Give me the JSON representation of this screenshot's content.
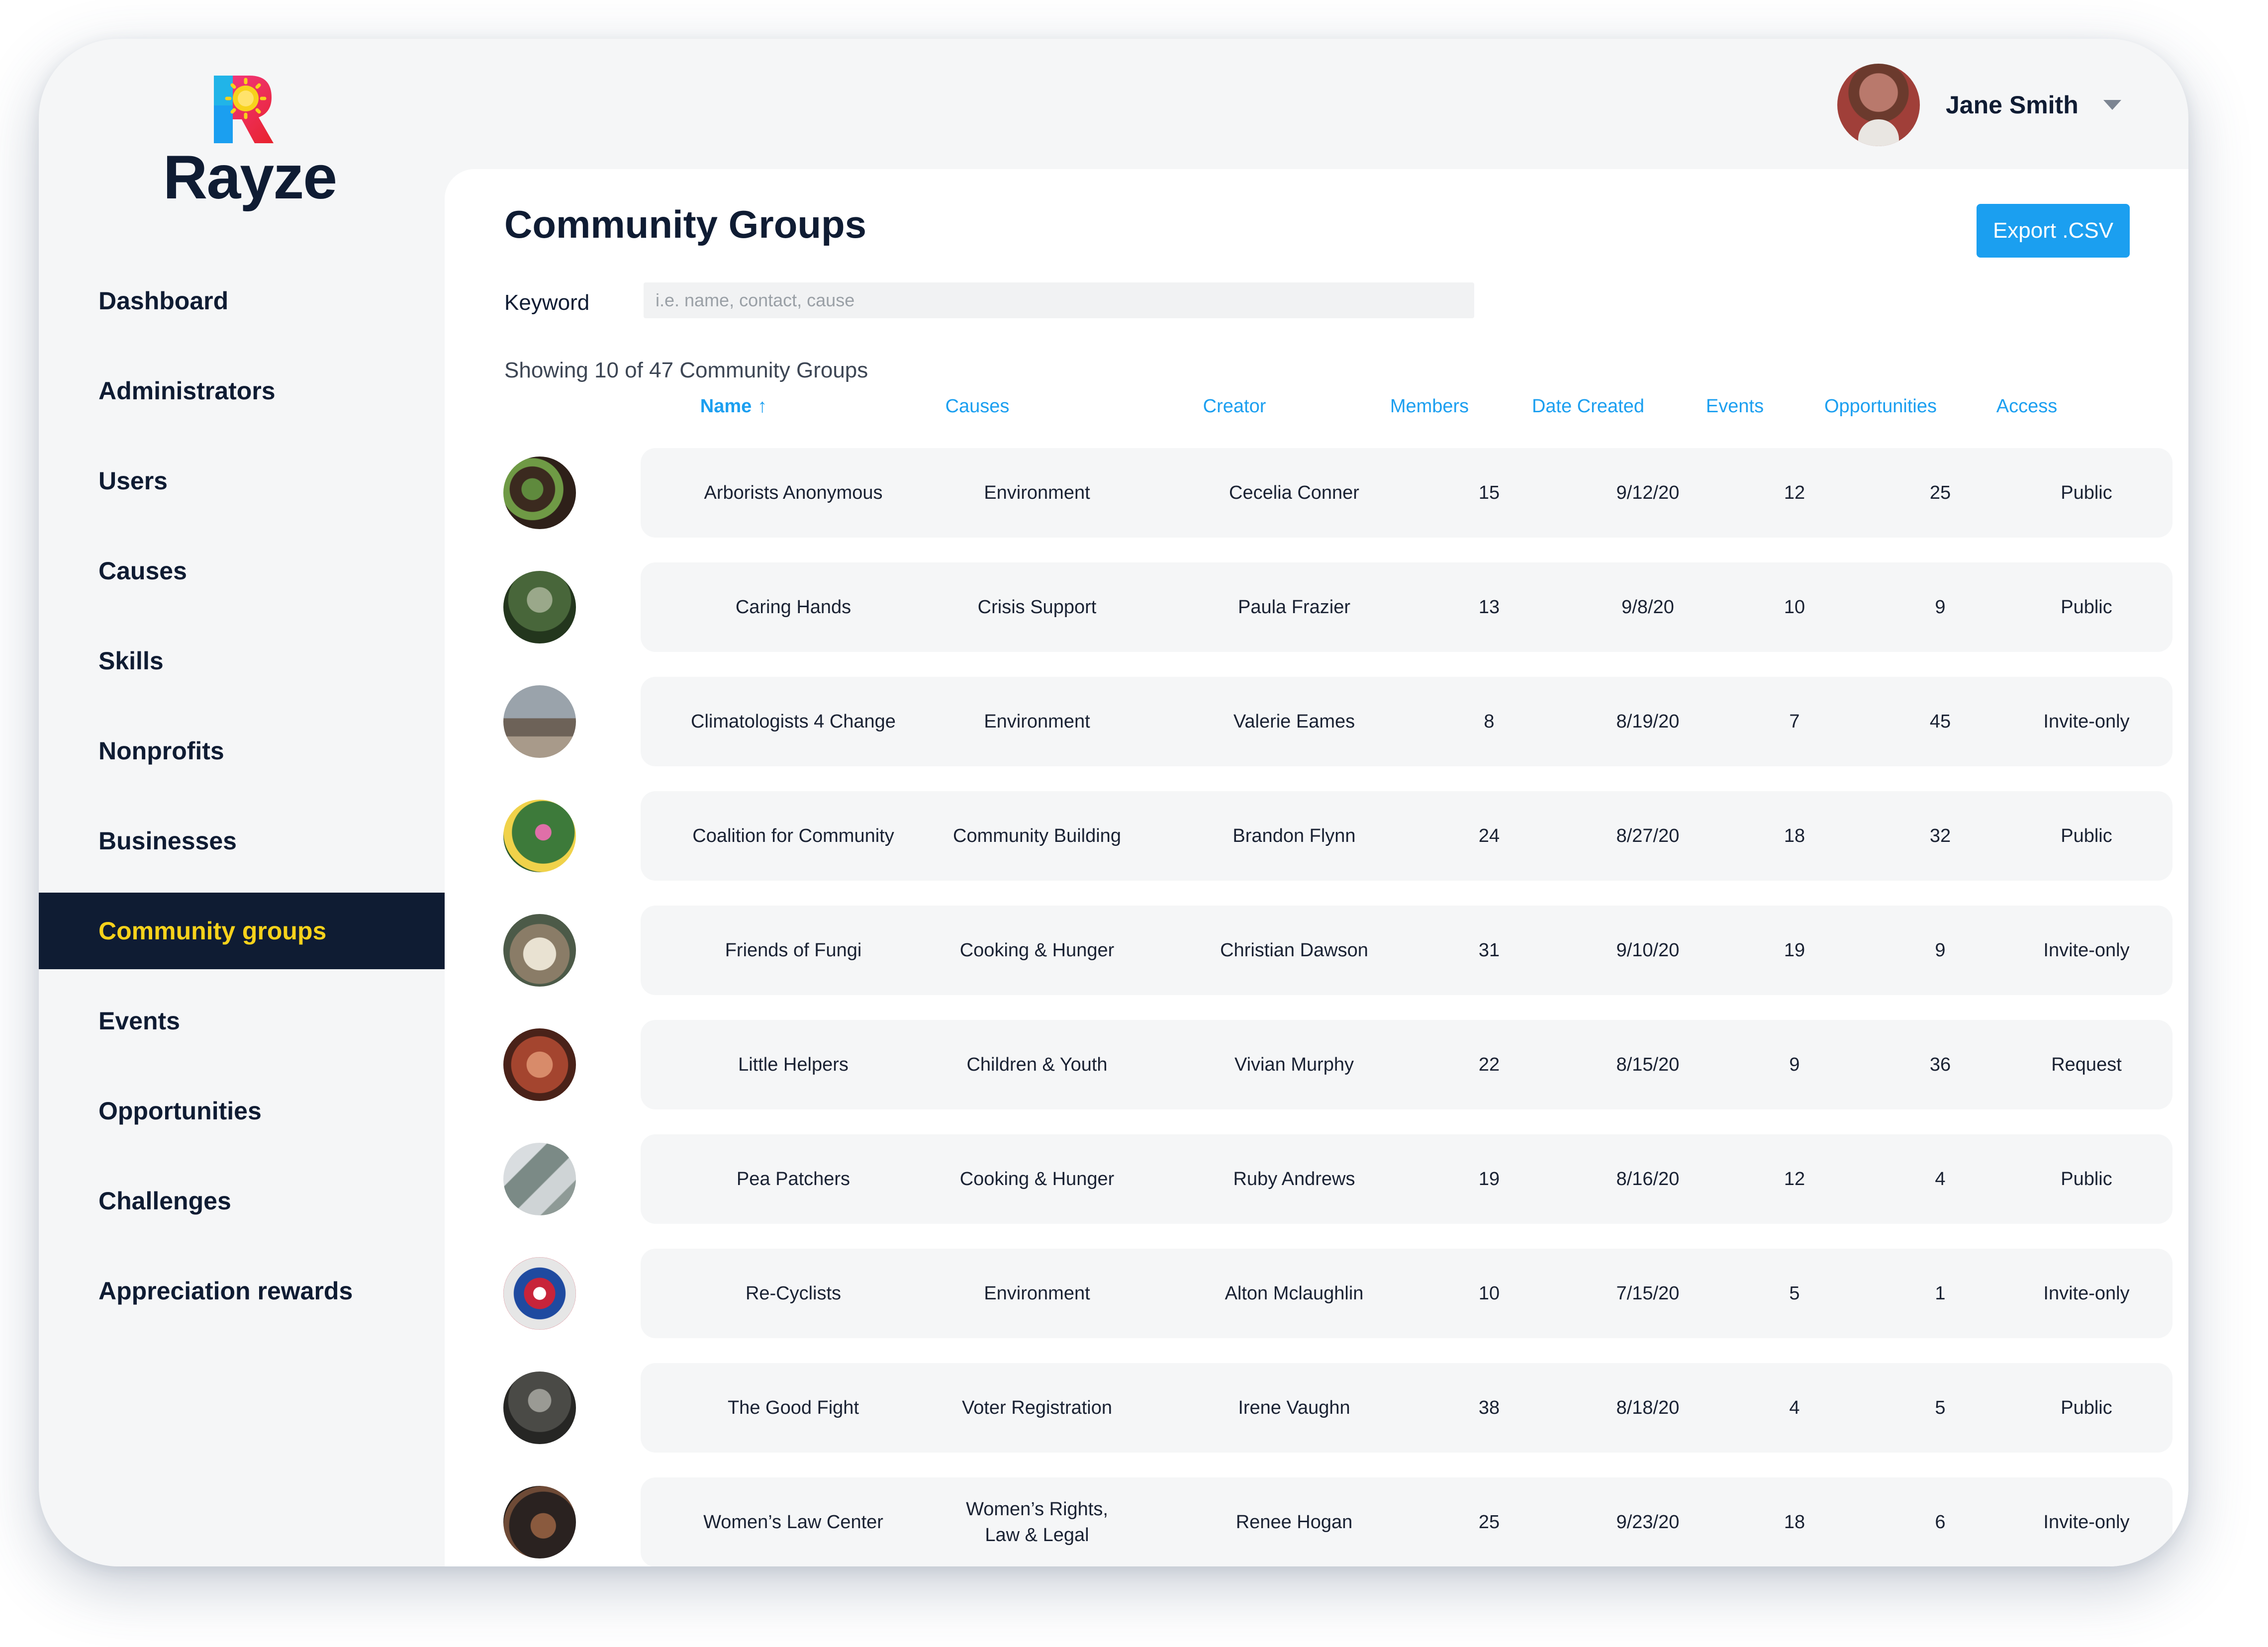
{
  "brand": {
    "name": "Rayze"
  },
  "user": {
    "name": "Jane Smith"
  },
  "nav": {
    "items": [
      {
        "label": "Dashboard"
      },
      {
        "label": "Administrators"
      },
      {
        "label": "Users"
      },
      {
        "label": "Causes"
      },
      {
        "label": "Skills"
      },
      {
        "label": "Nonprofits"
      },
      {
        "label": "Businesses"
      },
      {
        "label": "Community groups",
        "active": true
      },
      {
        "label": "Events"
      },
      {
        "label": "Opportunities"
      },
      {
        "label": "Challenges"
      },
      {
        "label": "Appreciation rewards"
      }
    ]
  },
  "page": {
    "title": "Community Groups",
    "export_label": "Export .CSV",
    "keyword_label": "Keyword",
    "keyword_placeholder": "i.e. name, contact, cause",
    "showing": "Showing 10 of 47 Community Groups"
  },
  "table": {
    "columns": [
      "Name",
      "Causes",
      "Creator",
      "Members",
      "Date Created",
      "Events",
      "Opportunities",
      "Access"
    ],
    "sort_arrow": "↑",
    "rows": [
      {
        "name": "Arborists Anonymous",
        "causes": "Environment",
        "creator": "Cecelia Conner",
        "members": "15",
        "date": "9/12/20",
        "events": "12",
        "opportunities": "25",
        "access": "Public"
      },
      {
        "name": "Caring Hands",
        "causes": "Crisis Support",
        "creator": "Paula Frazier",
        "members": "13",
        "date": "9/8/20",
        "events": "10",
        "opportunities": "9",
        "access": "Public"
      },
      {
        "name": "Climatologists 4 Change",
        "causes": "Environment",
        "creator": "Valerie Eames",
        "members": "8",
        "date": "8/19/20",
        "events": "7",
        "opportunities": "45",
        "access": "Invite-only"
      },
      {
        "name": "Coalition for Community",
        "causes": "Community Building",
        "creator": "Brandon Flynn",
        "members": "24",
        "date": "8/27/20",
        "events": "18",
        "opportunities": "32",
        "access": "Public"
      },
      {
        "name": "Friends of Fungi",
        "causes": "Cooking & Hunger",
        "creator": "Christian Dawson",
        "members": "31",
        "date": "9/10/20",
        "events": "19",
        "opportunities": "9",
        "access": "Invite-only"
      },
      {
        "name": "Little Helpers",
        "causes": "Children & Youth",
        "creator": "Vivian Murphy",
        "members": "22",
        "date": "8/15/20",
        "events": "9",
        "opportunities": "36",
        "access": "Request"
      },
      {
        "name": "Pea Patchers",
        "causes": "Cooking & Hunger",
        "creator": "Ruby Andrews",
        "members": "19",
        "date": "8/16/20",
        "events": "12",
        "opportunities": "4",
        "access": "Public"
      },
      {
        "name": "Re-Cyclists",
        "causes": "Environment",
        "creator": "Alton Mclaughlin",
        "members": "10",
        "date": "7/15/20",
        "events": "5",
        "opportunities": "1",
        "access": "Invite-only"
      },
      {
        "name": "The Good Fight",
        "causes": "Voter Registration",
        "creator": "Irene Vaughn",
        "members": "38",
        "date": "8/18/20",
        "events": "4",
        "opportunities": "5",
        "access": "Public"
      },
      {
        "name": "Women’s Law Center",
        "causes": "Women’s Rights,\nLaw & Legal",
        "creator": "Renee Hogan",
        "members": "25",
        "date": "9/23/20",
        "events": "18",
        "opportunities": "6",
        "access": "Invite-only"
      }
    ]
  },
  "colors": {
    "navy": "#0f1c33",
    "accent_yellow": "#f7d21b",
    "accent_blue": "#1b9ff0",
    "row_bg": "#f5f6f7"
  }
}
